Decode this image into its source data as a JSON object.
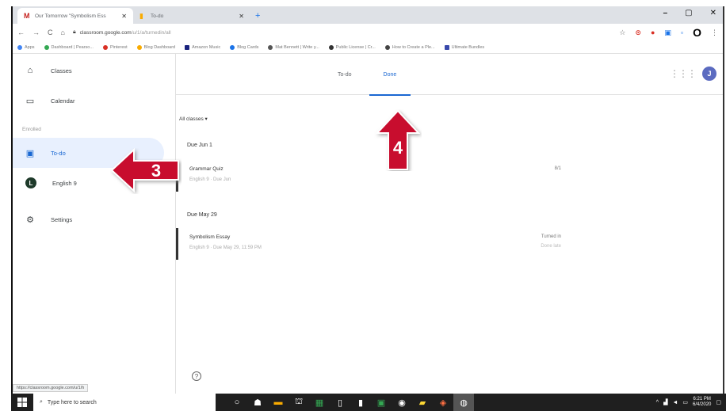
{
  "browser": {
    "tabs": [
      {
        "label": "Our Tomorrow \"Symbolism Ess",
        "active": true
      },
      {
        "label": "To-do",
        "active": false
      }
    ],
    "url_host": "classroom.google.com",
    "url_path": "/u/1/a/turnedin/all",
    "bookmarks": [
      "Apps",
      "Dashboard | Pearso...",
      "Pinterest",
      "Blog Dashboard",
      "Amazon Music",
      "Blog Cards",
      "Mat Bennett | Write y...",
      "Public License | Cr...",
      "How to Create a Ple...",
      "Ultimate Bundles"
    ],
    "window_controls": [
      "–",
      "▢",
      "✕"
    ]
  },
  "sidebar": {
    "items": [
      {
        "label": "Classes"
      },
      {
        "label": "Calendar"
      }
    ],
    "enrolled_label": "Enrolled",
    "todo_label": "To-do",
    "class_item": {
      "label": "English 9",
      "avatar": "L"
    },
    "settings_label": "Settings",
    "status_url": "https://classroom.google.com/u/1/h"
  },
  "main": {
    "tabs": [
      {
        "label": "To-do"
      },
      {
        "label": "Done"
      }
    ],
    "user_initial": "J",
    "filter_label": "All classes",
    "sections": [
      {
        "heading": "Due Jun 1",
        "item": {
          "title": "Grammar Quiz",
          "subtitle": "English 9 · Due Jun",
          "right1": "8/1",
          "right2": ""
        }
      },
      {
        "heading": "Due May 29",
        "item": {
          "title": "Symbolism Essay",
          "subtitle": "English 9 · Due May 29, 11:59 PM",
          "right1": "Turned in",
          "right2": "Done late"
        }
      }
    ],
    "help": "?"
  },
  "annotations": {
    "arrow_3": "3",
    "arrow_4": "4",
    "color": "#c8102e"
  },
  "taskbar": {
    "search_placeholder": "Type here to search",
    "time": "6:21 PM",
    "date": "6/4/2020"
  }
}
